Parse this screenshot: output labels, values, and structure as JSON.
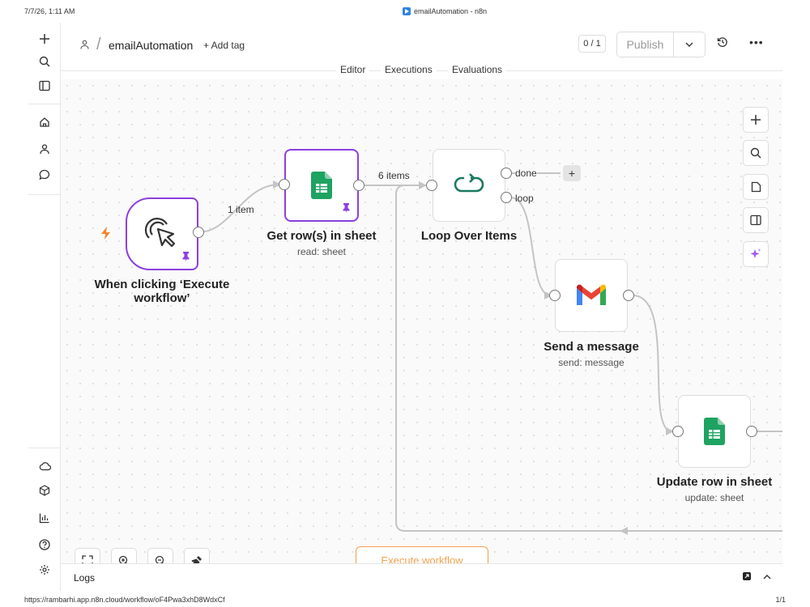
{
  "print": {
    "date": "7/7/26, 1:11 AM",
    "title": "emailAutomation - n8n",
    "url": "https://rambarhi.app.n8n.cloud/workflow/oF4Pwa3xhD8WdxCf",
    "page": "1/1"
  },
  "sidebar": {
    "top": [
      {
        "name": "add",
        "icon": "plus-icon"
      },
      {
        "name": "search",
        "icon": "search-icon"
      },
      {
        "name": "toggle-panel",
        "icon": "panel-icon"
      }
    ],
    "middle": [
      {
        "name": "home",
        "icon": "home-icon"
      },
      {
        "name": "personal",
        "icon": "user-icon"
      },
      {
        "name": "chat",
        "icon": "chat-icon"
      }
    ],
    "bottom": [
      {
        "name": "cloud",
        "icon": "cloud-icon"
      },
      {
        "name": "templates",
        "icon": "package-icon"
      },
      {
        "name": "insights",
        "icon": "bar-chart-icon"
      },
      {
        "name": "help",
        "icon": "help-icon"
      },
      {
        "name": "settings",
        "icon": "gear-icon"
      }
    ]
  },
  "header": {
    "workflow_name": "emailAutomation",
    "add_tag": "+ Add tag",
    "counter": "0 / 1",
    "publish": "Publish"
  },
  "tabs": [
    "Editor",
    "Executions",
    "Evaluations"
  ],
  "nodes": {
    "trigger": {
      "title": "When clicking ‘Execute workflow’"
    },
    "get_rows": {
      "title": "Get row(s) in sheet",
      "subtitle": "read: sheet"
    },
    "loop": {
      "title": "Loop Over Items",
      "out_done": "done",
      "out_loop": "loop"
    },
    "send": {
      "title": "Send a message",
      "subtitle": "send: message"
    },
    "update": {
      "title": "Update row in sheet",
      "subtitle": "update: sheet"
    }
  },
  "edges": {
    "trigger_to_get": "1 item",
    "get_to_loop": "6 items"
  },
  "colors": {
    "pinned_border": "#8b3fe0",
    "execute": "#f0a24e",
    "sheets_green": "#1ea362",
    "loop_teal": "#1b7a5e"
  },
  "actions": {
    "execute_workflow": "Execute workflow"
  },
  "logs": {
    "label": "Logs"
  }
}
